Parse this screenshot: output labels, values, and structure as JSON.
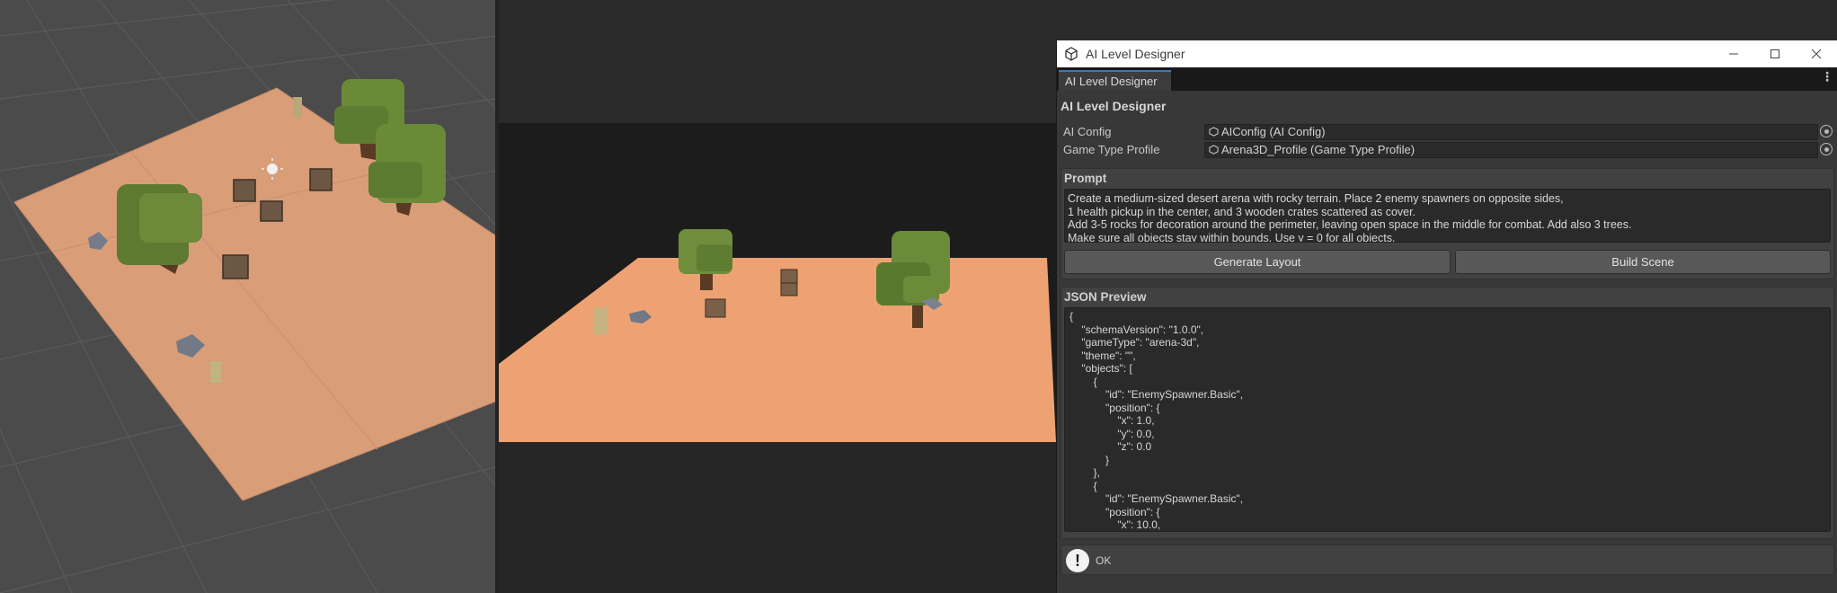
{
  "window": {
    "title": "AI Level Designer",
    "tab_label": "AI Level Designer",
    "header": "AI Level Designer",
    "controls": [
      "minimize-icon",
      "maximize-icon",
      "close-icon"
    ]
  },
  "fields": {
    "ai_config": {
      "label": "AI Config",
      "value": "AIConfig (AI Config)"
    },
    "game_type_profile": {
      "label": "Game Type Profile",
      "value": "Arena3D_Profile (Game Type Profile)"
    }
  },
  "prompt": {
    "title": "Prompt",
    "text": "Create a medium-sized desert arena with rocky terrain. Place 2 enemy spawners on opposite sides,\n1 health pickup in the center, and 3 wooden crates scattered as cover.\nAdd 3-5 rocks for decoration around the perimeter, leaving open space in the middle for combat. Add also 3 trees.\nMake sure all objects stay within bounds. Use y = 0 for all objects."
  },
  "buttons": {
    "generate": "Generate Layout",
    "build": "Build Scene"
  },
  "json_preview": {
    "title": "JSON Preview",
    "text": "{\n    \"schemaVersion\": \"1.0.0\",\n    \"gameType\": \"arena-3d\",\n    \"theme\": \"\",\n    \"objects\": [\n        {\n            \"id\": \"EnemySpawner.Basic\",\n            \"position\": {\n                \"x\": 1.0,\n                \"y\": 0.0,\n                \"z\": 0.0\n            }\n        },\n        {\n            \"id\": \"EnemySpawner.Basic\",\n            \"position\": {\n                \"x\": 10.0,"
  },
  "status": {
    "message": "OK",
    "icon": "info-exclamation-icon"
  },
  "colors": {
    "ground": "#f0a070",
    "tree_foliage": "#6e8c3a",
    "tab_accent": "#3a79bb",
    "scene_bg": "#4b4b4b"
  }
}
